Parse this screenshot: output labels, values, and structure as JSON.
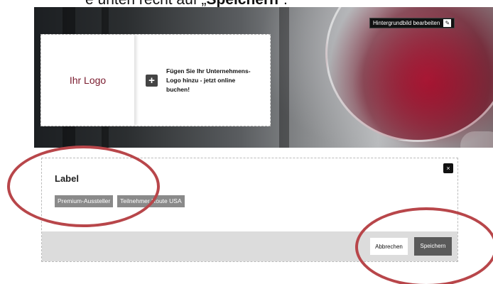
{
  "caption": {
    "prefix": "e unten recht auf „",
    "bold": "Speichern",
    "suffix": "“."
  },
  "hero": {
    "edit_background_label": "Hintergrundbild bearbeiten"
  },
  "logo_card": {
    "logo_placeholder": "Ihr Logo",
    "promo_text": "Fügen Sie Ihr Unternehmens-Logo hinzu - jetzt online buchen!"
  },
  "label_panel": {
    "title": "Label",
    "close_glyph": "×",
    "tags": [
      "Premium-Aussteller",
      "Teilnehmer Route USA"
    ],
    "cancel_label": "Abbrechen",
    "save_label": "Speichern"
  },
  "colors": {
    "annotation_ring": "#b8464a",
    "logo_text": "#7a1b2e"
  }
}
